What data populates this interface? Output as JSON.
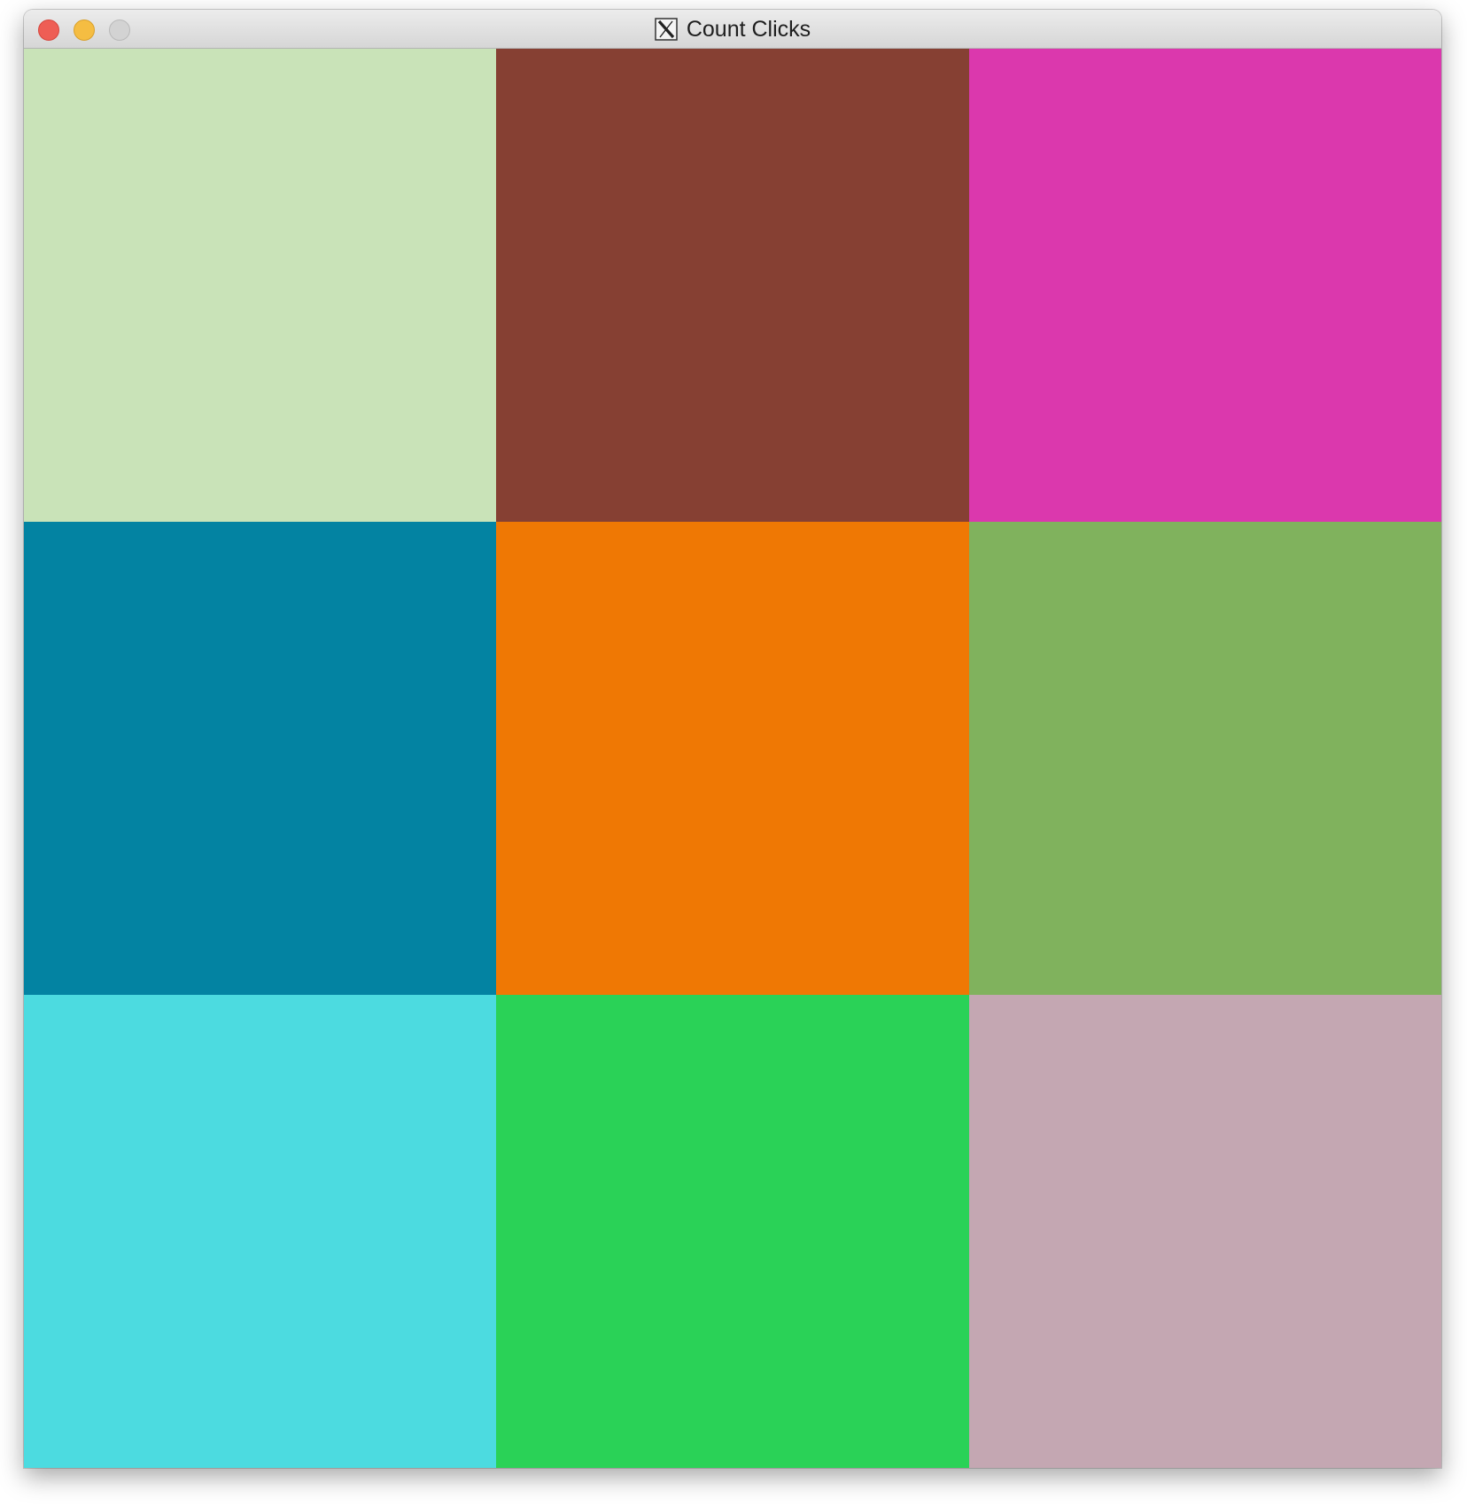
{
  "window": {
    "title": "Count Clicks",
    "title_icon": "x11-icon"
  },
  "traffic_lights": {
    "close_color": "#ee5e55",
    "minimize_color": "#f5bd42",
    "zoom_color": "#d3d3d3"
  },
  "grid": {
    "rows": 3,
    "columns": 3,
    "cells": [
      {
        "color": "#c9e3b8"
      },
      {
        "color": "#864033"
      },
      {
        "color": "#db38ad"
      },
      {
        "color": "#0383a2"
      },
      {
        "color": "#ef7804"
      },
      {
        "color": "#80b25d"
      },
      {
        "color": "#4cdbe0"
      },
      {
        "color": "#2ad257"
      },
      {
        "color": "#c4a7b2"
      }
    ]
  }
}
